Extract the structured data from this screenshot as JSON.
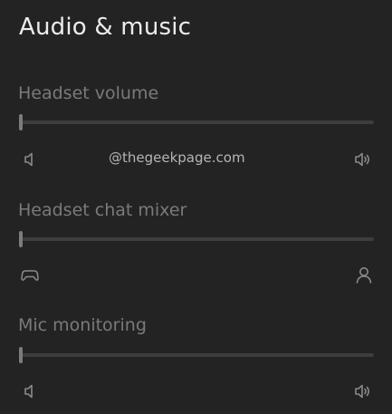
{
  "page": {
    "title": "Audio & music",
    "watermark": "@thegeekpage.com"
  },
  "settings": [
    {
      "label": "Headset volume",
      "value": 0,
      "left_icon": "speaker-low-icon",
      "right_icon": "speaker-high-icon"
    },
    {
      "label": "Headset chat mixer",
      "value": 0,
      "left_icon": "controller-icon",
      "right_icon": "person-icon"
    },
    {
      "label": "Mic monitoring",
      "value": 0,
      "left_icon": "speaker-low-icon",
      "right_icon": "speaker-high-icon"
    }
  ],
  "colors": {
    "background": "#232323",
    "title": "#ececec",
    "label": "#7a7a7a",
    "track": "#3d3d3d",
    "thumb": "#7c7c7c",
    "icon": "#8a8a8a"
  }
}
